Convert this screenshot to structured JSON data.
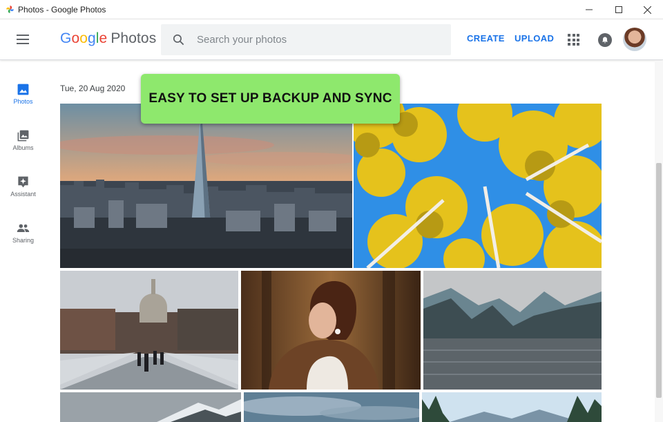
{
  "window": {
    "title": "Photos - Google Photos"
  },
  "header": {
    "logo": {
      "g1": "G",
      "o1": "o",
      "o2": "o",
      "g2": "g",
      "l": "l",
      "e": "e",
      "product": "Photos"
    },
    "search_placeholder": "Search your photos",
    "create_label": "CREATE",
    "upload_label": "UPLOAD"
  },
  "sidebar": {
    "items": [
      {
        "label": "Photos",
        "icon": "photo-icon",
        "active": true
      },
      {
        "label": "Albums",
        "icon": "albums-icon",
        "active": false
      },
      {
        "label": "Assistant",
        "icon": "assistant-icon",
        "active": false
      },
      {
        "label": "Sharing",
        "icon": "sharing-icon",
        "active": false
      }
    ]
  },
  "main": {
    "date_heading": "Tue, 20 Aug 2020",
    "banner_text": "EASY TO SET UP BACKUP AND SYNC"
  },
  "colors": {
    "accent": "#1a73e8",
    "banner": "#8ee86d"
  }
}
